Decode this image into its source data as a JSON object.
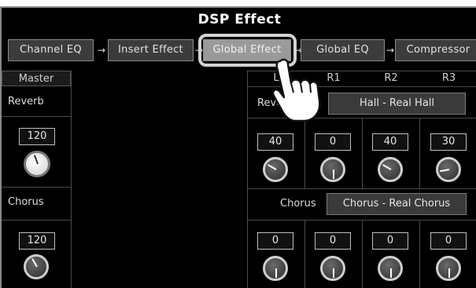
{
  "title": "DSP Effect",
  "tabs": [
    {
      "label": "Channel EQ"
    },
    {
      "label": "Insert Effect"
    },
    {
      "label": "Global Effect",
      "active": true
    },
    {
      "label": "Global EQ"
    },
    {
      "label": "Compressor"
    }
  ],
  "left_panel": {
    "header": "Master",
    "reverb_label": "Reverb",
    "reverb_value": "120",
    "chorus_label": "Chorus",
    "chorus_value": "120"
  },
  "right_panel": {
    "columns": [
      "L",
      "R1",
      "R2",
      "R3"
    ],
    "reverb_label": "Reverb",
    "reverb_type": "Hall - Real Hall",
    "reverb_values": [
      "40",
      "0",
      "40",
      "30"
    ],
    "chorus_label": "Chorus",
    "chorus_type": "Chorus - Real Chorus",
    "chorus_values": [
      "0",
      "0",
      "0",
      "0"
    ]
  },
  "icons": {
    "hand": "pointing-hand-icon",
    "arrow": "arrow-right-icon",
    "knob": "knob-icon"
  }
}
